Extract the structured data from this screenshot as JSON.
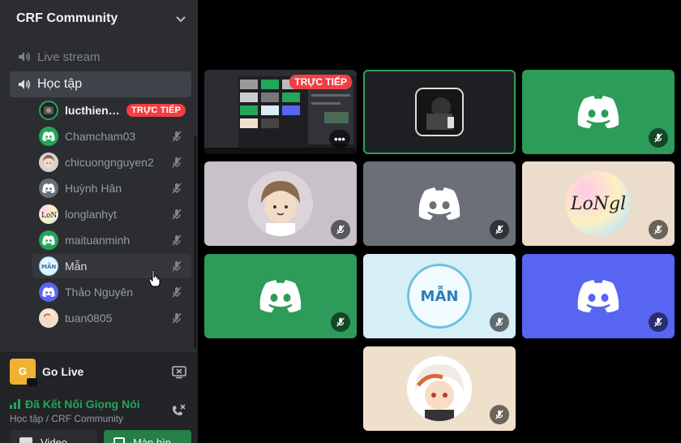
{
  "server": {
    "name": "CRF Community"
  },
  "channels": [
    {
      "name": "Live stream",
      "active": false
    },
    {
      "name": "Học tập",
      "active": true
    }
  ],
  "users": [
    {
      "name": "lucthienp...",
      "badge": "TRỰC TIẾP",
      "bold": true,
      "avatar": "stream"
    },
    {
      "name": "Chamcham03",
      "avatar": "discord-green"
    },
    {
      "name": "chicuongnguyen2",
      "avatar": "boy-cartoon"
    },
    {
      "name": "Huỳnh Hân",
      "avatar": "discord-gray"
    },
    {
      "name": "longlanhyt",
      "avatar": "longlanh"
    },
    {
      "name": "maituanminh",
      "avatar": "discord-green"
    },
    {
      "name": "Mẫn",
      "avatar": "man-logo",
      "hover": true
    },
    {
      "name": "Thảo Nguyên",
      "avatar": "discord-blurple"
    },
    {
      "name": "tuan0805",
      "avatar": "anime"
    }
  ],
  "golive": {
    "label": "Go Live",
    "logo_letter": "G"
  },
  "voice": {
    "status": "Đã Kết Nối Giọng Nói",
    "location": "Học tập / CRF Community",
    "video_label": "Video",
    "screen_label": "Màn hìn"
  },
  "tiles": [
    {
      "kind": "stream",
      "badge": "TRỰC TIẾP",
      "more": "•••"
    },
    {
      "kind": "selected",
      "avatar": "camera"
    },
    {
      "kind": "discord",
      "bg": "#2d9c5a"
    },
    {
      "kind": "avatar",
      "bg": "#c7c2c9",
      "avatar": "boy-cartoon"
    },
    {
      "kind": "discord",
      "bg": "#6b6f78"
    },
    {
      "kind": "avatar",
      "bg": "#ecdccb",
      "avatar": "longlanh",
      "text": "LoNgl"
    },
    {
      "kind": "discord",
      "bg": "#2d9c5a"
    },
    {
      "kind": "avatar",
      "bg": "#d6eef6",
      "avatar": "man-logo",
      "text": "MẪN"
    },
    {
      "kind": "discord",
      "bg": "#5865f2"
    },
    {
      "kind": "avatar",
      "bg": "#efe0cc",
      "avatar": "anime"
    }
  ],
  "colors": {
    "green": "#23a55a",
    "red": "#f23f43",
    "blurple": "#5865f2"
  }
}
